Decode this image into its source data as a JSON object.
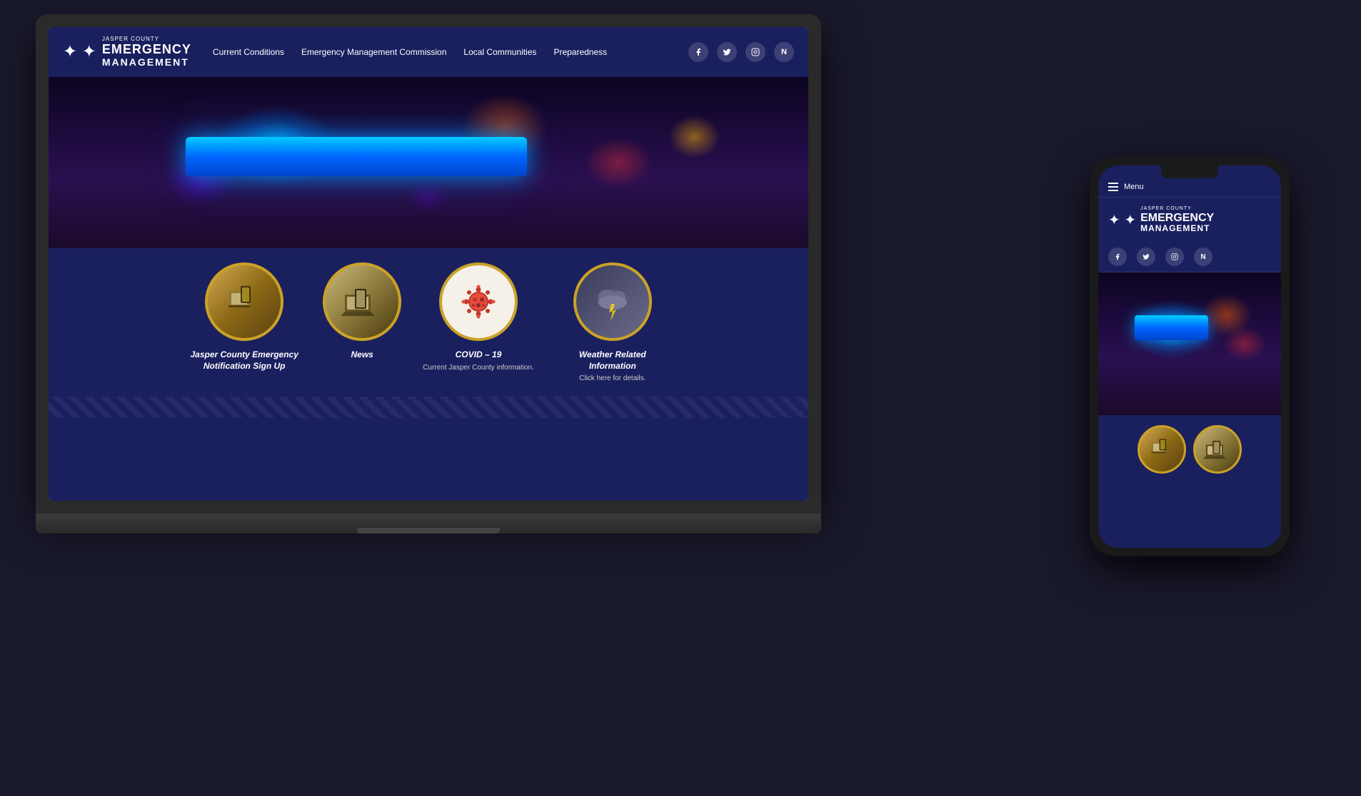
{
  "site": {
    "title": "Jasper County Emergency Management",
    "logo": {
      "jasper_county": "JASPER COUNTY",
      "emergency": "EMERGENCY",
      "management": "MANAGEMENT"
    }
  },
  "nav": {
    "links": [
      {
        "label": "Current Conditions"
      },
      {
        "label": "Emergency Management Commission"
      },
      {
        "label": "Local Communities"
      },
      {
        "label": "Preparedness"
      }
    ],
    "social": [
      {
        "name": "facebook",
        "icon": "f"
      },
      {
        "name": "twitter",
        "icon": "t"
      },
      {
        "name": "instagram",
        "icon": "i"
      },
      {
        "name": "nextdoor",
        "icon": "n"
      }
    ]
  },
  "cards": [
    {
      "id": "signup",
      "title": "Jasper County Emergency Notification Sign Up",
      "subtitle": ""
    },
    {
      "id": "news",
      "title": "News",
      "subtitle": ""
    },
    {
      "id": "covid",
      "title": "COVID – 19",
      "subtitle": "Current Jasper County information."
    },
    {
      "id": "weather",
      "title": "Weather Related Information",
      "subtitle": "Click here for details."
    }
  ],
  "phone": {
    "menu_label": "Menu",
    "social": [
      {
        "name": "facebook",
        "icon": "f"
      },
      {
        "name": "twitter",
        "icon": "t"
      },
      {
        "name": "instagram",
        "icon": "i"
      },
      {
        "name": "nextdoor",
        "icon": "n"
      }
    ]
  },
  "colors": {
    "nav_bg": "#1a1f5e",
    "accent_gold": "#c9a227",
    "hero_blue": "#00aaff",
    "body_bg": "#1a1a2e"
  }
}
